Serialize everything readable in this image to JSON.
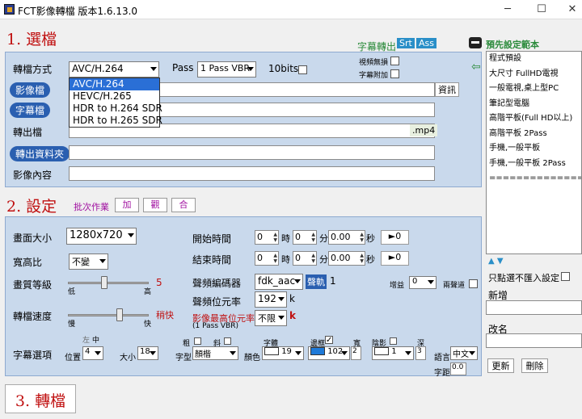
{
  "window": {
    "title": "FCT影像轉檔 版本1.6.13.0",
    "min": "─",
    "max": "☐",
    "close": "✕"
  },
  "section1": {
    "title": "1. 選檔",
    "subtitle_output": "字幕轉出",
    "btn_srt": "Srt",
    "btn_ass": "Ass",
    "format_label": "轉檔方式",
    "format_value": "AVC/H.264",
    "format_options": [
      "AVC/H.264",
      "HEVC/H.265",
      "HDR to H.264 SDR",
      "HDR to H.265 SDR"
    ],
    "pass_label": "Pass",
    "pass_value": "1 Pass VBR",
    "bits_label": "10bits",
    "video_lossless": "視頻無損",
    "subtitle_attach": "字幕附加",
    "video_file": "影像檔",
    "subtitle_file": "字幕檔",
    "info_btn": "資訊",
    "output_file": "轉出檔",
    "ext": ".mp4",
    "output_folder": "轉出資料夾",
    "video_content": "影像內容"
  },
  "presets": {
    "title": "預先設定範本",
    "items": [
      "程式預設",
      "大尺寸 FullHD電視",
      "一般電視,桌上型PC",
      "筆記型電腦",
      "高階平板(Full HD以上)",
      "高階平板 2Pass",
      "手機,一般平板",
      "手機,一般平板  2Pass",
      "==============="
    ],
    "no_import": "只點選不匯入設定",
    "new_label": "新增",
    "name_label": "改名",
    "update_btn": "更新",
    "delete_btn": "刪除"
  },
  "section2": {
    "title": "2. 設定",
    "batch_label": "批次作業",
    "add": "加",
    "view": "觀",
    "merge": "合",
    "size_label": "畫面大小",
    "size_value": "1280x720",
    "aspect_label": "寬高比",
    "aspect_value": "不變",
    "quality_label": "畫質等級",
    "quality_low": "低",
    "quality_high": "高",
    "quality_value": "5",
    "speed_label": "轉檔速度",
    "speed_slow": "慢",
    "speed_fast": "快",
    "speed_value": "稍快",
    "start_label": "開始時間",
    "end_label": "結束時間",
    "h": "時",
    "m": "分",
    "s": "秒",
    "start_h": "0",
    "start_m": "0",
    "start_s": "0.00",
    "end_h": "0",
    "end_m": "0",
    "end_s": "0.00",
    "to_zero": "►0",
    "audio_codec_label": "聲頻編碼器",
    "audio_codec_value": "fdk_aac",
    "audio_btn": "聲軌",
    "audio_track": "1",
    "gain_label": "增益",
    "gain_value": "0",
    "two_channel": "兩聲道",
    "audio_bitrate_label": "聲頻位元率",
    "audio_bitrate_value": "192",
    "k": "k",
    "video_bitrate_label": "影像最高位元率",
    "video_bitrate_value": "不限",
    "video_bitrate_note": "(1 Pass VBR)",
    "sub_label": "字幕選項",
    "mid": "中",
    "left": "左",
    "pos_label": "位置",
    "pos_value": "4",
    "size2_label": "大小",
    "size2_value": "18",
    "bold": "粗",
    "italic": "斜",
    "font_label": "字型",
    "font_value": "顏楷",
    "color_label": "顏色",
    "color_value": "19",
    "body_label": "字體",
    "border_label": "邊框",
    "border_value": "102",
    "width_label": "寬",
    "width_value": "2",
    "shadow_label": "陰影",
    "shadow_value": "1",
    "depth_label": "深",
    "depth_value": "3",
    "lang_label": "語言",
    "lang_value": "中文",
    "spacing_label": "字距",
    "spacing_value": "0.0"
  },
  "section3": {
    "title": "3. 轉檔"
  }
}
